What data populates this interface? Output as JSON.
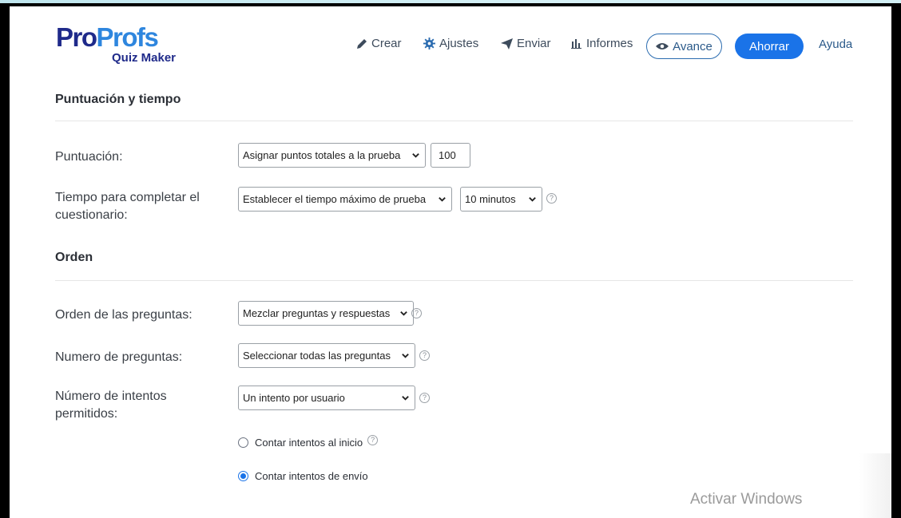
{
  "logo": {
    "main_pro": "Pro",
    "main_profs": "Profs",
    "sub": "Quiz Maker"
  },
  "nav": {
    "crear": "Crear",
    "ajustes": "Ajustes",
    "enviar": "Enviar",
    "informes": "Informes",
    "avance": "Avance",
    "ahorrar": "Ahorrar",
    "ayuda": "Ayuda"
  },
  "scoring": {
    "title": "Puntuación y tiempo",
    "score_label": "Puntuación:",
    "score_select": "Asignar puntos totales a la prueba",
    "score_value": "100",
    "time_label": "Tiempo para completar el cuestionario:",
    "time_select": "Establecer el tiempo máximo de prueba",
    "time_value": "10 minutos"
  },
  "order": {
    "title": "Orden",
    "question_order_label": "Orden de las preguntas:",
    "question_order_select": "Mezclar preguntas y respuestas",
    "question_count_label": "Numero de preguntas:",
    "question_count_select": "Seleccionar todas las preguntas",
    "attempts_label": "Número de intentos permitidos:",
    "attempts_select": "Un intento por usuario",
    "radio_start": "Contar intentos al inicio",
    "radio_submit": "Contar intentos de envío",
    "radio_selected": "submit"
  },
  "help_glyph": "?",
  "watermark": "Activar Windows",
  "colors": {
    "primary": "#1a73e8",
    "logo_dark": "#1f2a8a",
    "logo_light": "#2e86de"
  }
}
